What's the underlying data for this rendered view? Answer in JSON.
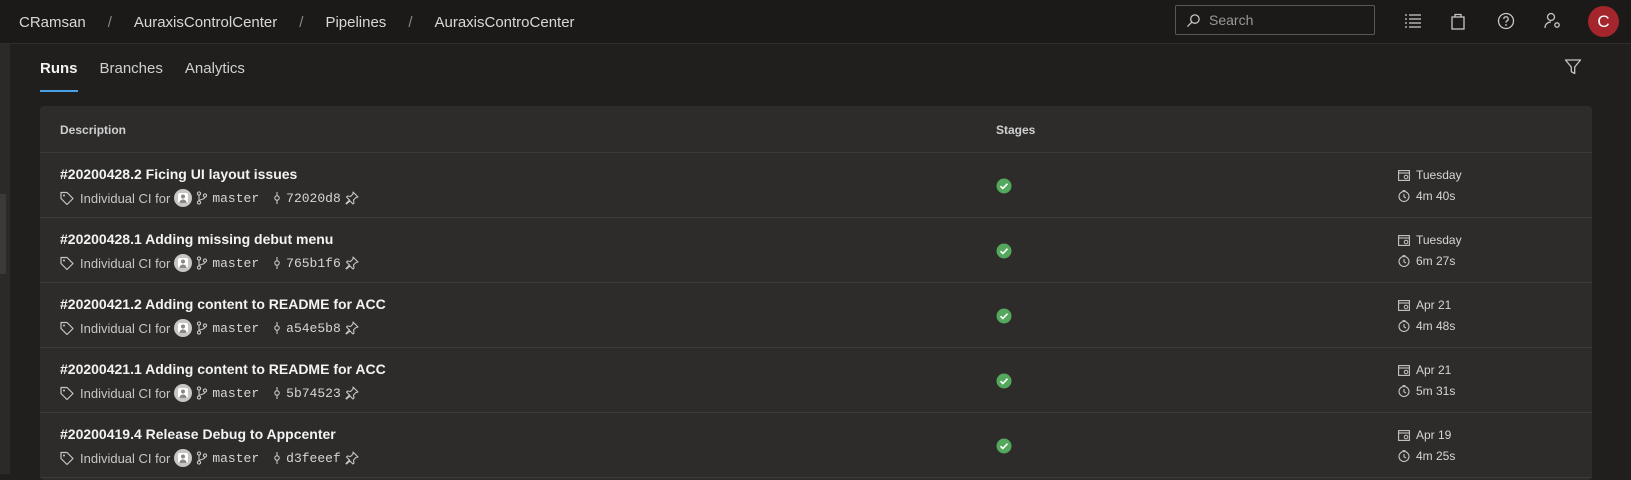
{
  "breadcrumb": [
    "CRamsan",
    "AuraxisControlCenter",
    "Pipelines",
    "AuraxisControCenter"
  ],
  "search": {
    "placeholder": "Search"
  },
  "user": {
    "initial": "C"
  },
  "tabs": [
    "Runs",
    "Branches",
    "Analytics"
  ],
  "table": {
    "headers": {
      "description": "Description",
      "stages": "Stages"
    },
    "rows": [
      {
        "title": "#20200428.2 Ficing UI layout issues",
        "trigger": "Individual CI for",
        "branch": "master",
        "commit": "72020d8",
        "date": "Tuesday",
        "duration": "4m 40s"
      },
      {
        "title": "#20200428.1 Adding missing debut menu",
        "trigger": "Individual CI for",
        "branch": "master",
        "commit": "765b1f6",
        "date": "Tuesday",
        "duration": "6m 27s"
      },
      {
        "title": "#20200421.2 Adding content to README for ACC",
        "trigger": "Individual CI for",
        "branch": "master",
        "commit": "a54e5b8",
        "date": "Apr 21",
        "duration": "4m 48s"
      },
      {
        "title": "#20200421.1 Adding content to README for ACC",
        "trigger": "Individual CI for",
        "branch": "master",
        "commit": "5b74523",
        "date": "Apr 21",
        "duration": "5m 31s"
      },
      {
        "title": "#20200419.4 Release Debug to Appcenter",
        "trigger": "Individual CI for",
        "branch": "master",
        "commit": "d3feeef",
        "date": "Apr 19",
        "duration": "4m 25s"
      }
    ]
  },
  "colors": {
    "success": "#54a85c",
    "accent": "#4aa0e6",
    "avatar": "#a4262c"
  },
  "icons": [
    "search-icon",
    "list-icon",
    "bag-icon",
    "help-icon",
    "user-settings-icon",
    "filter-icon",
    "tag-icon",
    "branch-icon",
    "commit-icon",
    "pin-icon",
    "calendar-icon",
    "clock-icon",
    "success-icon"
  ]
}
